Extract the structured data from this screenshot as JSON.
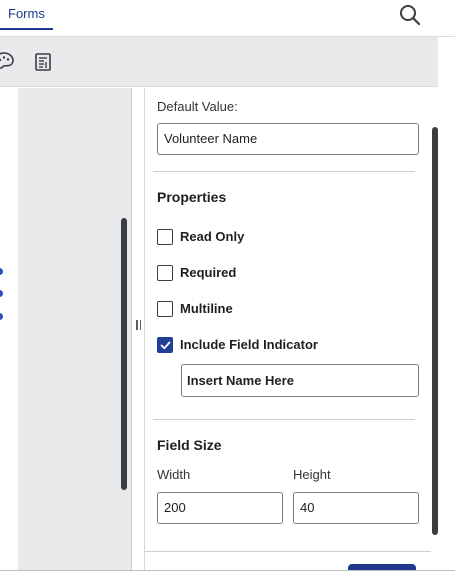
{
  "tabs": {
    "active_label": "Forms"
  },
  "icons": {
    "search": "search-icon",
    "palette": "palette-icon",
    "form_settings": "form-settings-icon",
    "splitter_grip": "drag-handle-icon"
  },
  "panel": {
    "default_value_label": "Default Value:",
    "default_value": "Volunteer Name",
    "properties_title": "Properties",
    "checks": [
      {
        "label": "Read Only",
        "checked": false
      },
      {
        "label": "Required",
        "checked": false
      },
      {
        "label": "Multiline",
        "checked": false
      },
      {
        "label": "Include Field Indicator",
        "checked": true
      }
    ],
    "indicator_text": "Insert Name Here",
    "field_size_title": "Field Size",
    "width_label": "Width",
    "height_label": "Height",
    "width_value": "200",
    "height_value": "40"
  },
  "colors": {
    "accent": "#1f3f99",
    "tab_text": "#1a3a8c",
    "toolbar_bg": "#e8e9eb",
    "selection_handle": "#2a4cc0"
  }
}
